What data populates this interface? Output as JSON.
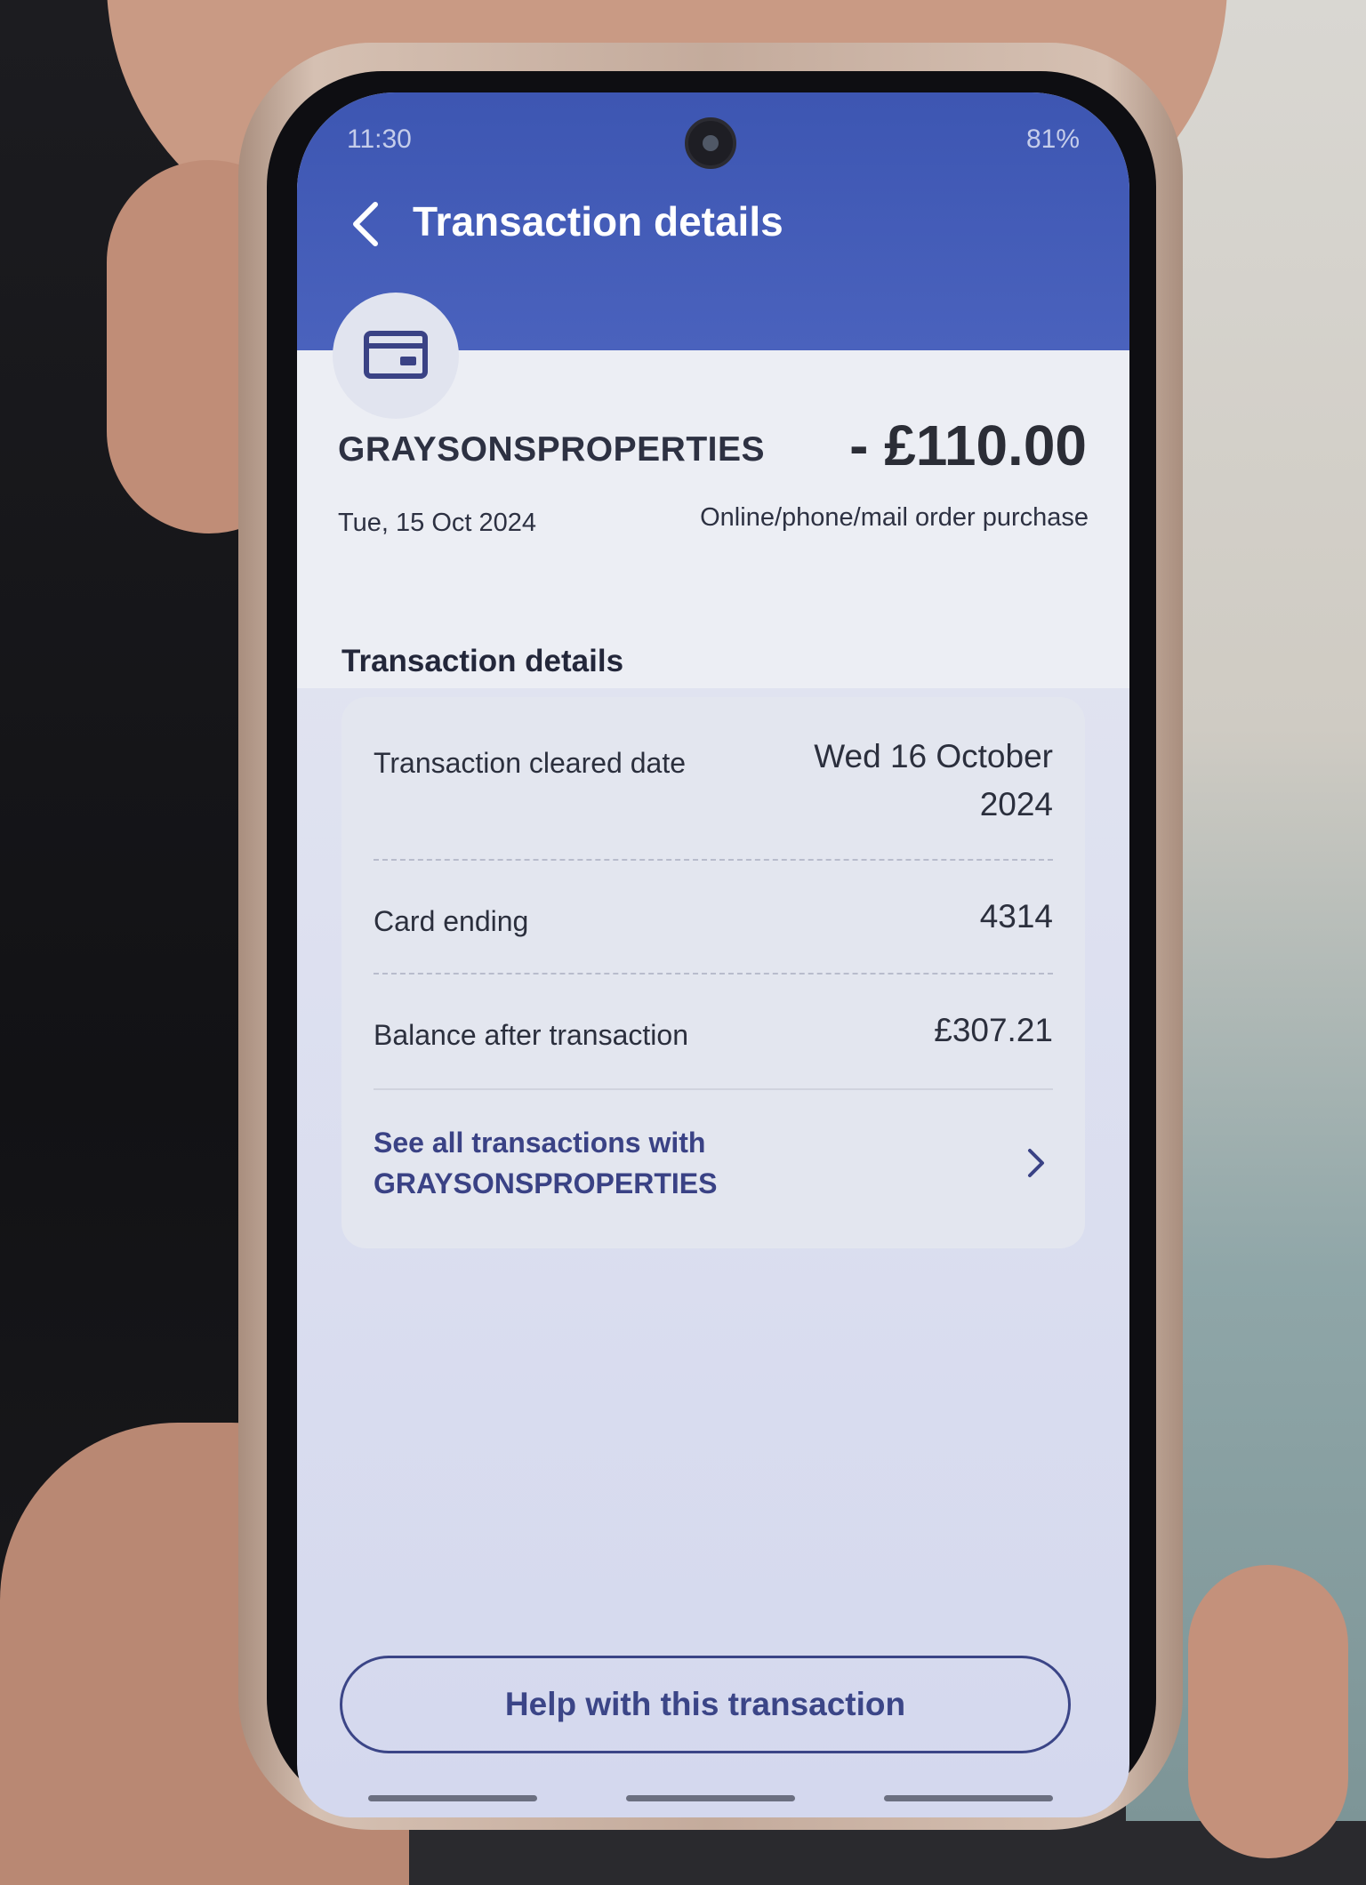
{
  "status_bar": {
    "time": "11:30",
    "battery": "81%"
  },
  "header": {
    "title": "Transaction details",
    "back_icon": "chevron-left-icon",
    "color": "#3d56b2"
  },
  "summary": {
    "card_icon": "card-icon",
    "merchant": "GRAYSONSPROPERTIES",
    "amount": "- £110.00",
    "date": "Tue, 15 Oct 2024",
    "purchase_type": "Online/phone/mail order purchase"
  },
  "details": {
    "section_title": "Transaction details",
    "rows": [
      {
        "label": "Transaction cleared date",
        "value_line1": "Wed 16 October",
        "value_line2": "2024"
      },
      {
        "label": "Card ending",
        "value": "4314"
      },
      {
        "label": "Balance after transaction",
        "value": "£307.21"
      }
    ],
    "link_line1": "See all transactions with",
    "link_line2": "GRAYSONSPROPERTIES"
  },
  "help_button": {
    "label": "Help with this transaction"
  }
}
